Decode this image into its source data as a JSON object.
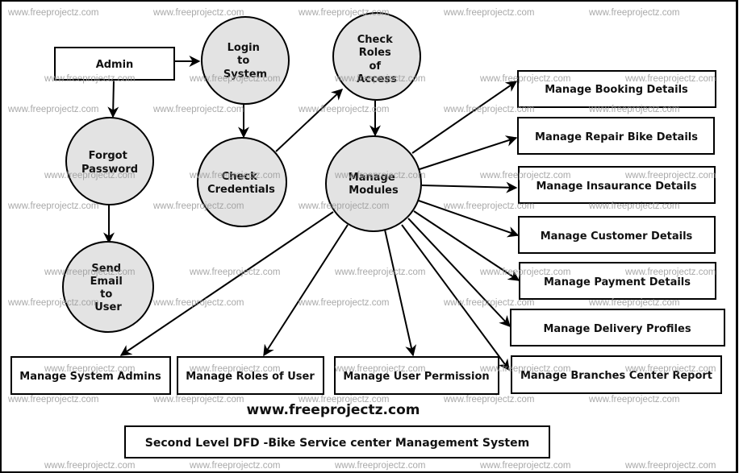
{
  "diagram": {
    "title": "Second Level DFD -Bike Service center Management System",
    "website": "www.freeprojectz.com",
    "watermark": "www.freeprojectz.com",
    "colors": {
      "process_fill": "#e3e3e3",
      "stroke": "#000000",
      "watermark": "#9a9a9a",
      "background": "#ffffff"
    },
    "entities": {
      "admin": "Admin",
      "manage_booking": "Manage Booking Details",
      "manage_repair": "Manage Repair Bike Details",
      "manage_insurance": "Manage Insaurance Details",
      "manage_customer": "Manage Customer Details",
      "manage_payment": "Manage Payment Details",
      "manage_delivery": "Manage Delivery Profiles",
      "manage_branches": "Manage Branches Center Report",
      "manage_admins": "Manage System Admins",
      "manage_roles": "Manage Roles of User",
      "manage_permission": "Manage User Permission"
    },
    "processes": {
      "login": [
        "Login",
        "to",
        "System"
      ],
      "check_roles": [
        "Check",
        "Roles",
        "of",
        "Access"
      ],
      "forgot": [
        "Forgot",
        "Password"
      ],
      "check_credentials": [
        "Check",
        "Credentials"
      ],
      "manage_modules": [
        "Manage",
        "Modules"
      ],
      "send_email": [
        "Send",
        "Email",
        "to",
        "User"
      ]
    },
    "flows": [
      {
        "from": "Admin",
        "to": "Login to System"
      },
      {
        "from": "Admin",
        "to": "Forgot Password"
      },
      {
        "from": "Forgot Password",
        "to": "Send Email to User"
      },
      {
        "from": "Login to System",
        "to": "Check Credentials"
      },
      {
        "from": "Check Credentials",
        "to": "Check Roles of Access"
      },
      {
        "from": "Check Roles of Access",
        "to": "Manage Modules"
      },
      {
        "from": "Manage Modules",
        "to": "Manage Booking Details"
      },
      {
        "from": "Manage Modules",
        "to": "Manage Repair Bike Details"
      },
      {
        "from": "Manage Modules",
        "to": "Manage Insaurance Details"
      },
      {
        "from": "Manage Modules",
        "to": "Manage Customer Details"
      },
      {
        "from": "Manage Modules",
        "to": "Manage Payment Details"
      },
      {
        "from": "Manage Modules",
        "to": "Manage Delivery Profiles"
      },
      {
        "from": "Manage Modules",
        "to": "Manage Branches Center Report"
      },
      {
        "from": "Manage Modules",
        "to": "Manage System Admins"
      },
      {
        "from": "Manage Modules",
        "to": "Manage Roles of User"
      },
      {
        "from": "Manage Modules",
        "to": "Manage User Permission"
      }
    ]
  }
}
